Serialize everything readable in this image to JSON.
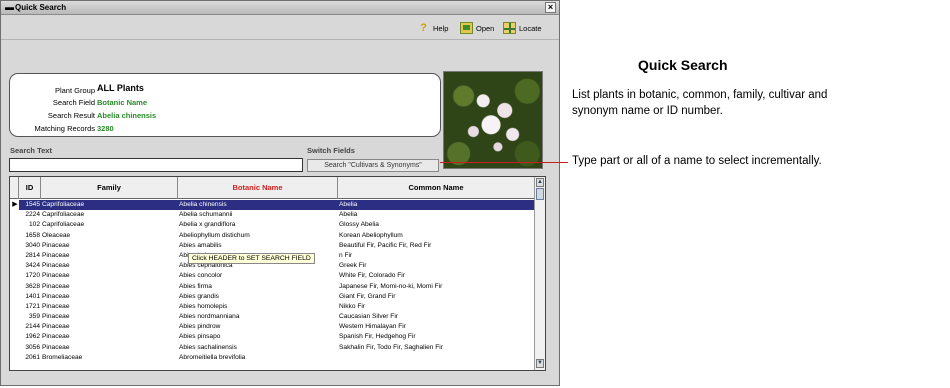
{
  "window": {
    "title": "Quick Search",
    "menu_glyph": "▬",
    "close_glyph": "×"
  },
  "toolbar": {
    "help_label": "Help",
    "open_label": "Open",
    "locate_label": "Locate"
  },
  "info": {
    "plant_group_label": "Plant Group",
    "plant_group_value": "ALL Plants",
    "search_field_label": "Search Field",
    "search_field_value": "Botanic Name",
    "search_result_label": "Search Result",
    "search_result_value": "Abelia chinensis",
    "matching_records_label": "Matching Records",
    "matching_records_value": "3280"
  },
  "search": {
    "label": "Search Text",
    "value": "",
    "switch_label": "Switch Fields",
    "switch_button": "Search \"Cultivars & Synonyms\""
  },
  "grid": {
    "headers": {
      "id": "ID",
      "family": "Family",
      "botanic": "Botanic Name",
      "common": "Common Name"
    },
    "marker_glyph": "▶",
    "selected_index": 0,
    "rows": [
      {
        "id": "1545",
        "family": "Caprifoliaceae",
        "botanic": "Abelia chinensis",
        "common": "Abelia"
      },
      {
        "id": "2224",
        "family": "Caprifoliaceae",
        "botanic": "Abelia schumannii",
        "common": "Abelia"
      },
      {
        "id": "102",
        "family": "Caprifoliaceae",
        "botanic": "Abelia x grandiflora",
        "common": "Glossy Abelia"
      },
      {
        "id": "1658",
        "family": "Oleaceae",
        "botanic": "Abeliophyllum distichum",
        "common": "Korean Abeliophyllum"
      },
      {
        "id": "3040",
        "family": "Pinaceae",
        "botanic": "Abies amabilis",
        "common": "Beautiful Fir, Pacific Fir, Red Fir"
      },
      {
        "id": "2814",
        "family": "Pinaceae",
        "botanic": "Abies balsam",
        "common": "n Fir"
      },
      {
        "id": "3424",
        "family": "Pinaceae",
        "botanic": "Abies cephalonica",
        "common": "Greek Fir"
      },
      {
        "id": "1720",
        "family": "Pinaceae",
        "botanic": "Abies concolor",
        "common": "White Fir, Colorado Fir"
      },
      {
        "id": "3628",
        "family": "Pinaceae",
        "botanic": "Abies firma",
        "common": "Japanese Fir, Momi-no-ki, Momi Fir"
      },
      {
        "id": "1401",
        "family": "Pinaceae",
        "botanic": "Abies grandis",
        "common": "Giant Fir, Grand Fir"
      },
      {
        "id": "1721",
        "family": "Pinaceae",
        "botanic": "Abies homolepis",
        "common": "Nikko Fir"
      },
      {
        "id": "359",
        "family": "Pinaceae",
        "botanic": "Abies nordmanniana",
        "common": "Caucasian Silver Fir"
      },
      {
        "id": "2144",
        "family": "Pinaceae",
        "botanic": "Abies pindrow",
        "common": "Western Himalayan Fir"
      },
      {
        "id": "1962",
        "family": "Pinaceae",
        "botanic": "Abies pinsapo",
        "common": "Spanish Fir, Hedgehog Fir"
      },
      {
        "id": "3056",
        "family": "Pinaceae",
        "botanic": "Abies sachalinensis",
        "common": "Sakhalin Fir, Todo Fir, Saghalien Fir"
      },
      {
        "id": "2061",
        "family": "Bromeliaceae",
        "botanic": "Abromeitiella brevifolia",
        "common": ""
      }
    ],
    "scroll_up": "▲",
    "scroll_down": "▼"
  },
  "tooltip": "Click HEADER to SET SEARCH FIELD",
  "annotation": {
    "title": "Quick Search",
    "description": "List plants in botanic, common, family, cultivar and synonym name or ID number.",
    "type_hint": "Type part or all of a name to select incrementally."
  },
  "colors": {
    "selected_row": "#2b2e83",
    "header_active": "#d02020",
    "value_green": "#2a8a2a",
    "callout_line": "#c81e1e"
  }
}
